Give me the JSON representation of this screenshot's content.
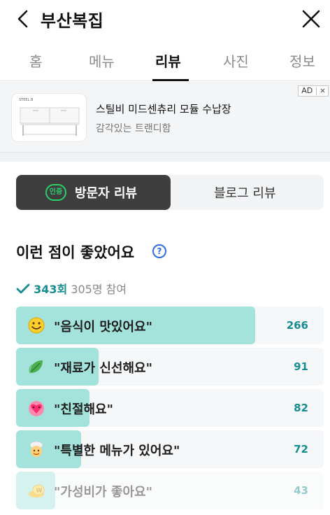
{
  "header": {
    "title": "부산복집"
  },
  "tabs": [
    {
      "label": "홈"
    },
    {
      "label": "메뉴"
    },
    {
      "label": "리뷰",
      "active": true
    },
    {
      "label": "사진"
    },
    {
      "label": "정보"
    }
  ],
  "ad": {
    "badge": "AD",
    "title": "스틸비 미드센츄리 모듈 수납장",
    "subtitle": "감각있는 트랜디함",
    "thumb_brand": "STEEL.B"
  },
  "review_toggle": {
    "badge": "인증",
    "visitor_label": "방문자 리뷰",
    "blog_label": "블로그 리뷰"
  },
  "section": {
    "title": "이런 점이 좋았어요",
    "help_icon": "?",
    "count": "343회",
    "participants": "305명 참여"
  },
  "colors": {
    "accent": "#168e91",
    "bar_fill": "#a3e3dc",
    "help_blue": "#2e6ce6"
  },
  "highlights": [
    {
      "icon": "smile-emoji-icon",
      "label": "\"음식이 맛있어요\"",
      "count": "266"
    },
    {
      "icon": "leaf-emoji-icon",
      "label": "\"재료가 신선해요\"",
      "count": "91"
    },
    {
      "icon": "heart-emoji-icon",
      "label": "\"친절해요\"",
      "count": "82"
    },
    {
      "icon": "chef-emoji-icon",
      "label": "\"특별한 메뉴가 있어요\"",
      "count": "72"
    },
    {
      "icon": "coin-emoji-icon",
      "label": "\"가성비가 좋아요\"",
      "count": "43"
    }
  ]
}
